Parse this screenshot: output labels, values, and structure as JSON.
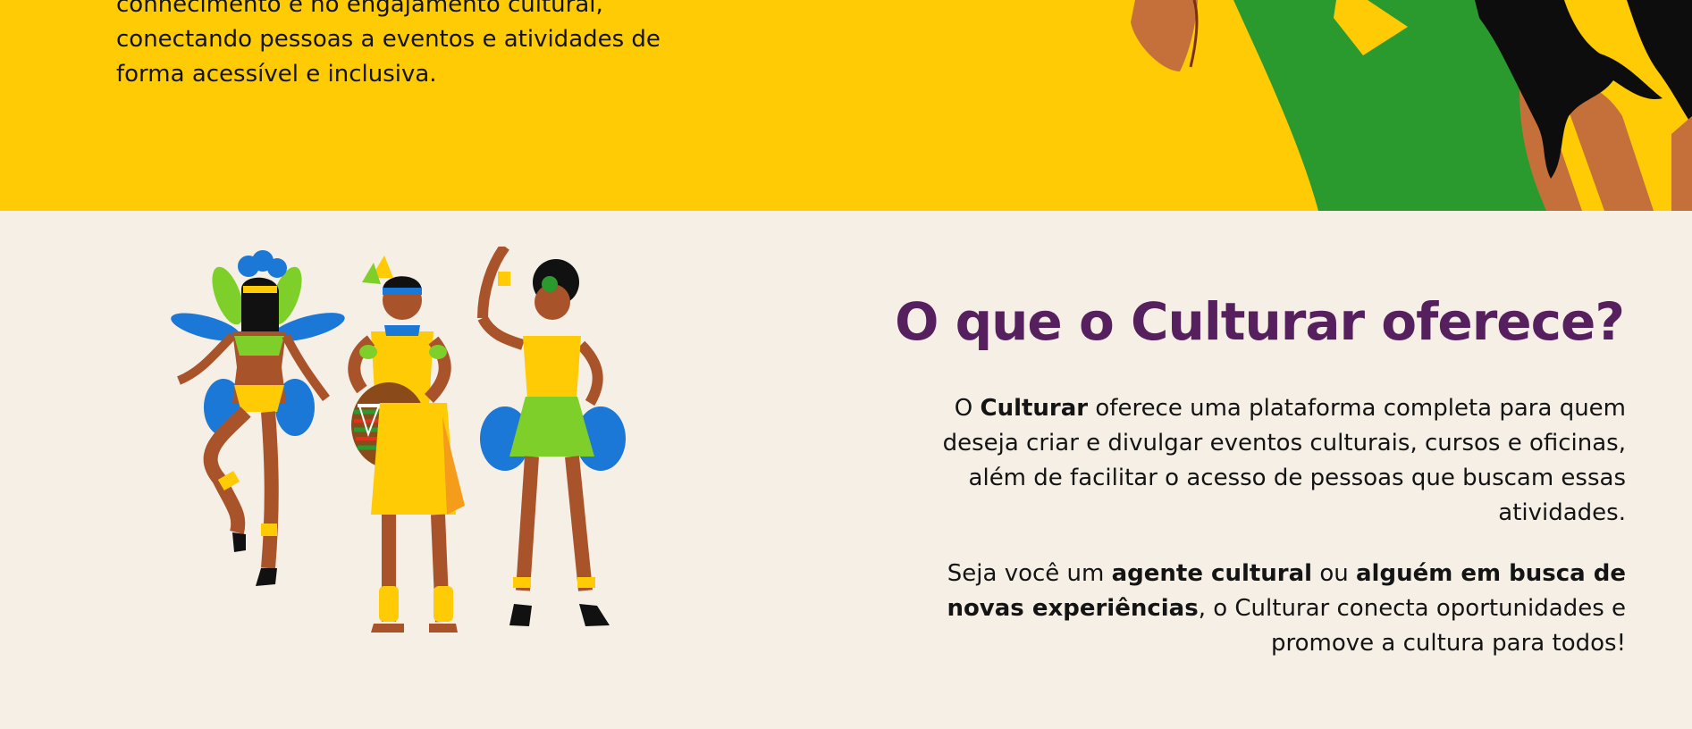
{
  "hero": {
    "text_line1": "conhecimento e no engajamento cultural,",
    "text_line2": "conectando pessoas a eventos e atividades de",
    "text_line3": "forma acessível e inclusiva."
  },
  "about": {
    "title": "O que o Culturar oferece?",
    "p1_prefix": "O ",
    "p1_brand": "Culturar",
    "p1_rest": " oferece uma plataforma completa para quem deseja criar e divulgar eventos culturais, cursos e oficinas, além de facilitar o acesso de pessoas que buscam essas atividades.",
    "p2_prefix": "Seja você um ",
    "p2_bold1": "agente cultural",
    "p2_mid": " ou ",
    "p2_bold2": "alguém em busca de novas experiências",
    "p2_rest": ", o Culturar conecta oportunidades e promove a cultura para todos!"
  },
  "colors": {
    "hero_bg": "#ffcb05",
    "section_bg": "#f5efe5",
    "title": "#56205e",
    "green": "#2a9a2e"
  },
  "illustrations": {
    "hero_art": "carnival-woman-illustration",
    "section_art": "carnival-dancers-illustration"
  }
}
